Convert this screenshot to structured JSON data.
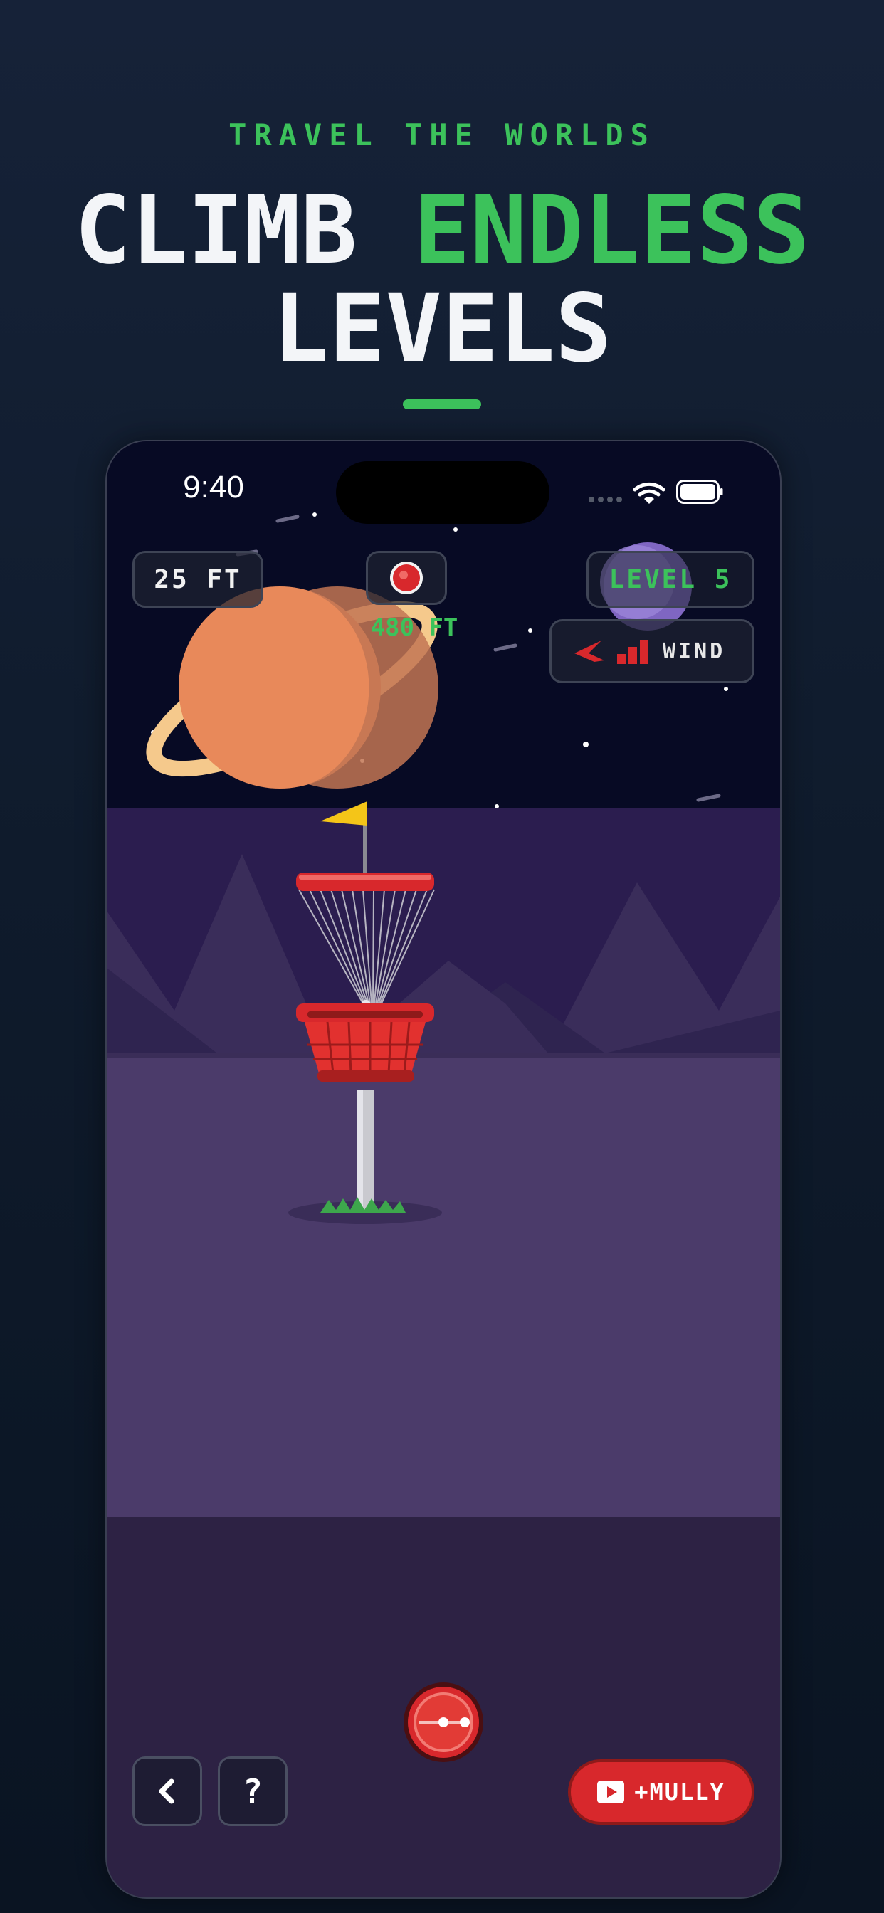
{
  "promo": {
    "tagline": "TRAVEL THE WORLDS",
    "headline_part1": "CLIMB ",
    "headline_highlight": "ENDLESS",
    "headline_line2": "LEVELS"
  },
  "status_bar": {
    "time": "9:40",
    "icons": [
      "cellular-signal-icon",
      "wifi-icon",
      "battery-icon"
    ]
  },
  "hud": {
    "throw_distance": "25 FT",
    "hole_distance": "480 FT",
    "level": "LEVEL 5",
    "wind_label": "WIND",
    "wind_strength_bars": 3
  },
  "controls": {
    "help_label": "?",
    "mully_label": "+MULLY"
  },
  "icons": {
    "back": "chevron-left-icon",
    "video": "video-play-icon",
    "target": "target-dot-icon",
    "wind": "wind-direction-arrow-icon",
    "disc": "disc-icon"
  },
  "colors": {
    "accent_green": "#3cc25b",
    "accent_red": "#d8282c",
    "sky": "#070a24",
    "ground": "#4b3b6a"
  }
}
